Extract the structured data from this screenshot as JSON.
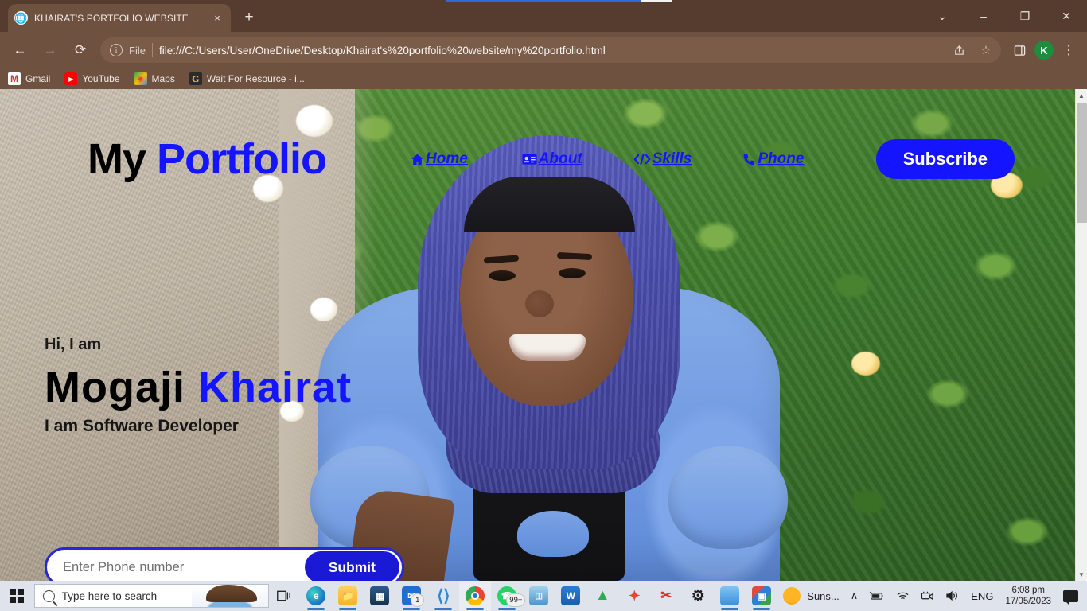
{
  "browser": {
    "tab": {
      "title": "KHAIRAT'S PORTFOLIO WEBSITE",
      "favicon": "globe-icon",
      "close": "×"
    },
    "new_tab_label": "+",
    "window_controls": {
      "minimize_tabs": "⌄",
      "minimize": "–",
      "maximize": "❐",
      "close": "✕"
    },
    "toolbar": {
      "back": "←",
      "forward": "→",
      "reload": "⟳",
      "scheme_label": "File",
      "url": "file:///C:/Users/User/OneDrive/Desktop/Khairat's%20portfolio%20website/my%20portfolio.html",
      "share_icon": "share-icon",
      "bookmark_icon": "star-icon",
      "sidepanel_icon": "side-panel-icon",
      "profile_initial": "K",
      "menu_icon": "⋮"
    },
    "bookmarks": [
      {
        "label": "Gmail",
        "icon": "gmail-icon",
        "glyph": "M"
      },
      {
        "label": "YouTube",
        "icon": "youtube-icon",
        "glyph": "▶"
      },
      {
        "label": "Maps",
        "icon": "google-maps-icon",
        "glyph": "◉"
      },
      {
        "label": "Wait For Resource - i...",
        "icon": "google-g-icon",
        "glyph": "G"
      }
    ]
  },
  "page": {
    "brand": {
      "part1": "My ",
      "part2": "Portfolio"
    },
    "nav": [
      {
        "label": "Home",
        "icon": "home-icon"
      },
      {
        "label": "About",
        "icon": "id-card-icon"
      },
      {
        "label": "Skills",
        "icon": "code-icon"
      },
      {
        "label": "Phone",
        "icon": "phone-icon"
      }
    ],
    "subscribe_button": "Subscribe",
    "hero": {
      "greeting": "Hi, I am",
      "name_first": "Mogaji ",
      "name_last": "Khairat",
      "role": "I am Software Developer"
    },
    "form": {
      "placeholder": "Enter Phone number",
      "value": "",
      "submit_label": "Submit"
    },
    "colors": {
      "accent_blue": "#1414ff",
      "submit_blue": "#1a1ad6",
      "text_black": "#000000"
    },
    "scrollbar": {
      "up_arrow": "▲",
      "down_arrow": "▼"
    }
  },
  "taskbar": {
    "start": "windows-start-icon",
    "search_placeholder": "Type here to search",
    "task_view": "task-view-icon",
    "apps": [
      {
        "name": "microsoft-edge",
        "glyph": "e",
        "badge": "",
        "state": "running"
      },
      {
        "name": "file-explorer",
        "glyph": "▤",
        "badge": "",
        "state": "running"
      },
      {
        "name": "microsoft-store",
        "glyph": "⊞",
        "badge": "",
        "state": ""
      },
      {
        "name": "mail",
        "glyph": "✉",
        "badge": "1",
        "state": "running"
      },
      {
        "name": "visual-studio-code",
        "glyph": "⬣",
        "badge": "",
        "state": "running"
      },
      {
        "name": "google-chrome",
        "glyph": "◯",
        "badge": "",
        "state": "active"
      },
      {
        "name": "whatsapp",
        "glyph": "✆",
        "badge": "99+",
        "state": "running"
      },
      {
        "name": "remote-desktop",
        "glyph": "▣",
        "badge": "",
        "state": ""
      },
      {
        "name": "microsoft-word",
        "glyph": "W",
        "badge": "",
        "state": ""
      },
      {
        "name": "google-drive",
        "glyph": "△",
        "badge": "",
        "state": ""
      },
      {
        "name": "google-photos",
        "glyph": "✦",
        "badge": "",
        "state": ""
      },
      {
        "name": "snipping-tool",
        "glyph": "✂",
        "badge": "",
        "state": ""
      },
      {
        "name": "settings",
        "glyph": "⚙",
        "badge": "",
        "state": ""
      },
      {
        "name": "onedrive-folder",
        "glyph": "▰",
        "badge": "",
        "state": "running"
      },
      {
        "name": "winrar",
        "glyph": "░",
        "badge": "",
        "state": "running"
      }
    ],
    "tray": {
      "weather_label": "Suns...",
      "weather_icon": "sun-icon",
      "show_hidden_icons": "∧",
      "battery_icon": "battery-icon",
      "network_icon": "wifi-icon",
      "camera_icon": "camera-icon",
      "volume_icon": "volume-icon",
      "language": "ENG",
      "time": "6:08 pm",
      "date": "17/05/2023",
      "notifications_icon": "notification-icon"
    }
  }
}
